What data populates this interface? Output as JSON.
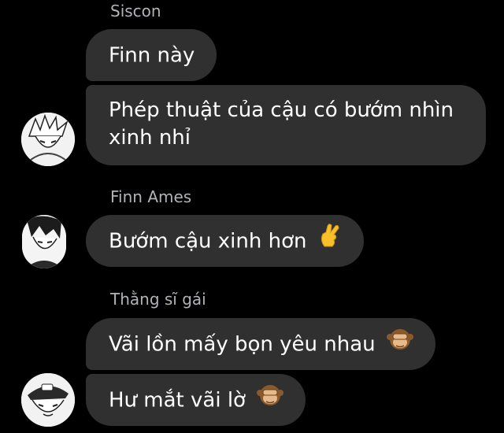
{
  "chat": {
    "groups": [
      {
        "sender": "Siscon",
        "messages": [
          "Finn này",
          "Phép thuật của cậu có bướm nhìn xinh nhỉ"
        ],
        "avatar_icon": "anime-boy-avatar-icon"
      },
      {
        "sender": "Finn Ames",
        "messages": [
          "Bướm cậu xinh hơn"
        ],
        "emoji": "crossed-fingers-emoji-icon",
        "avatar_icon": "anime-dark-hair-avatar-icon"
      },
      {
        "sender": "Thằng sĩ gái",
        "messages": [
          "Vãi lồn mấy bọn yêu nhau",
          "Hư mắt vãi lờ"
        ],
        "emoji": "see-no-evil-monkey-emoji-icon",
        "avatar_icon": "anime-cap-avatar-icon"
      }
    ],
    "colors": {
      "background": "#000000",
      "bubble": "#303030",
      "sender_name": "#b0b3b8",
      "message_text": "#ffffff"
    }
  }
}
